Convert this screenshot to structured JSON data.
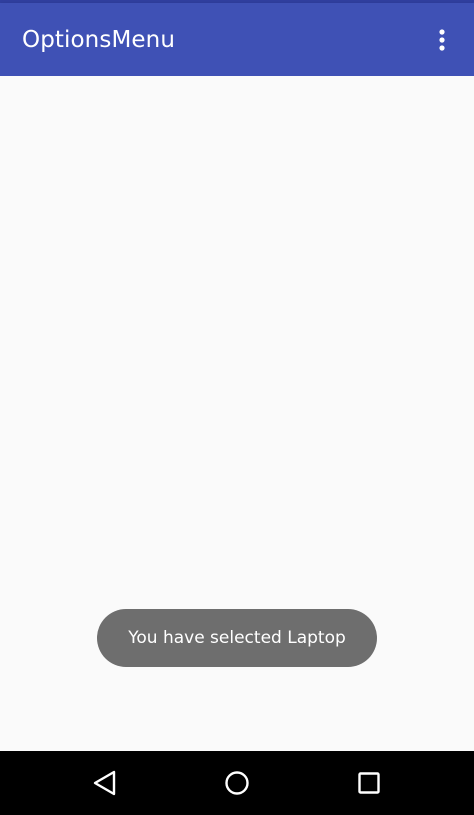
{
  "app_bar": {
    "title": "OptionsMenu",
    "overflow_icon": "more-vert-icon",
    "color": "#3f51b5"
  },
  "toast": {
    "message": "You have selected Laptop",
    "color": "#6e6e6e"
  },
  "nav_bar": {
    "buttons": [
      "back-icon",
      "home-icon",
      "recents-icon"
    ],
    "color": "#000000"
  },
  "content": {
    "background": "#fafafa"
  }
}
